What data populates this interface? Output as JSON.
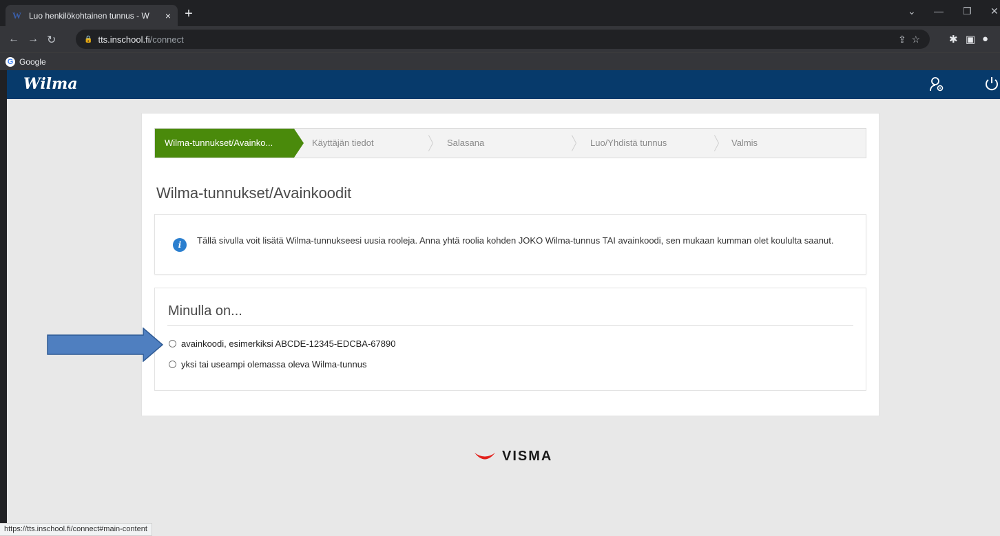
{
  "browser": {
    "tab_title": "Luo henkilökohtainen tunnus - W",
    "tab_close": "×",
    "new_tab": "+",
    "favicon_letter": "W",
    "url_host": "tts.inschool.fi",
    "url_path": "/connect",
    "bookmark_label": "Google",
    "status_url": "https://tts.inschool.fi/connect#main-content"
  },
  "header": {
    "logo": "Wilma"
  },
  "steps": [
    {
      "label": "Wilma-tunnukset/Avainko...",
      "active": true
    },
    {
      "label": "Käyttäjän tiedot",
      "active": false
    },
    {
      "label": "Salasana",
      "active": false
    },
    {
      "label": "Luo/Yhdistä tunnus",
      "active": false
    },
    {
      "label": "Valmis",
      "active": false
    }
  ],
  "page": {
    "title": "Wilma-tunnukset/Avainkoodit",
    "info_text": "Tällä sivulla voit lisätä Wilma-tunnukseesi uusia rooleja. Anna yhtä roolia kohden JOKO Wilma-tunnus TAI avainkoodi, sen mukaan kumman olet koululta saanut.",
    "choice_title": "Minulla on...",
    "options": [
      {
        "label": "avainkoodi, esimerkiksi ABCDE-12345-EDCBA-67890",
        "selected": false
      },
      {
        "label": "yksi tai useampi olemassa oleva Wilma-tunnus",
        "selected": false
      }
    ]
  },
  "footer": {
    "brand": "VISMA"
  },
  "colors": {
    "header_bg": "#073a6b",
    "active_step": "#4a8a0b",
    "info_icon": "#2b7fcf",
    "arrow_fill": "#4f7fc0",
    "visma_red": "#e2211c"
  }
}
